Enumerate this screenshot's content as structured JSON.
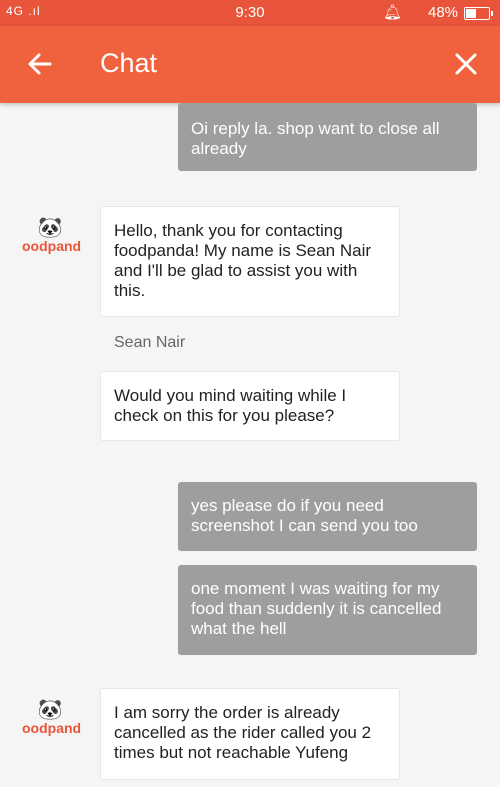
{
  "status": {
    "signal": "4G .ıl",
    "time": "9:30",
    "battery": "48%",
    "battery_level": 0.48,
    "icons": [
      "signal-icon",
      "alarm-icon",
      "battery-icon"
    ]
  },
  "appbar": {
    "title": "Chat",
    "back_icon": "arrow-left-icon",
    "close_icon": "close-icon",
    "color": "#f0623d"
  },
  "messages": [
    {
      "from": "user",
      "text": "Oi reply la.  shop want to close all already"
    },
    {
      "from": "agent",
      "avatar": "foodpanda-logo",
      "text": "Hello, thank you for contacting foodpanda! My name is Sean Nair and I'll be glad to assist you with this."
    },
    {
      "from": "agent-name",
      "text": "Sean Nair"
    },
    {
      "from": "agent",
      "text": "Would you mind waiting while I check on this for you please?"
    },
    {
      "from": "user",
      "text": "yes please do if you need screenshot I can send you too"
    },
    {
      "from": "user",
      "text": "one moment I was waiting for my food than suddenly it is cancelled what the hell"
    },
    {
      "from": "agent",
      "avatar": "foodpanda-logo",
      "text": "I am sorry the order is already cancelled as the rider called you 2 times but not reachable Yufeng"
    }
  ],
  "avatar": {
    "face": "🐼",
    "brand": "oodpand"
  }
}
